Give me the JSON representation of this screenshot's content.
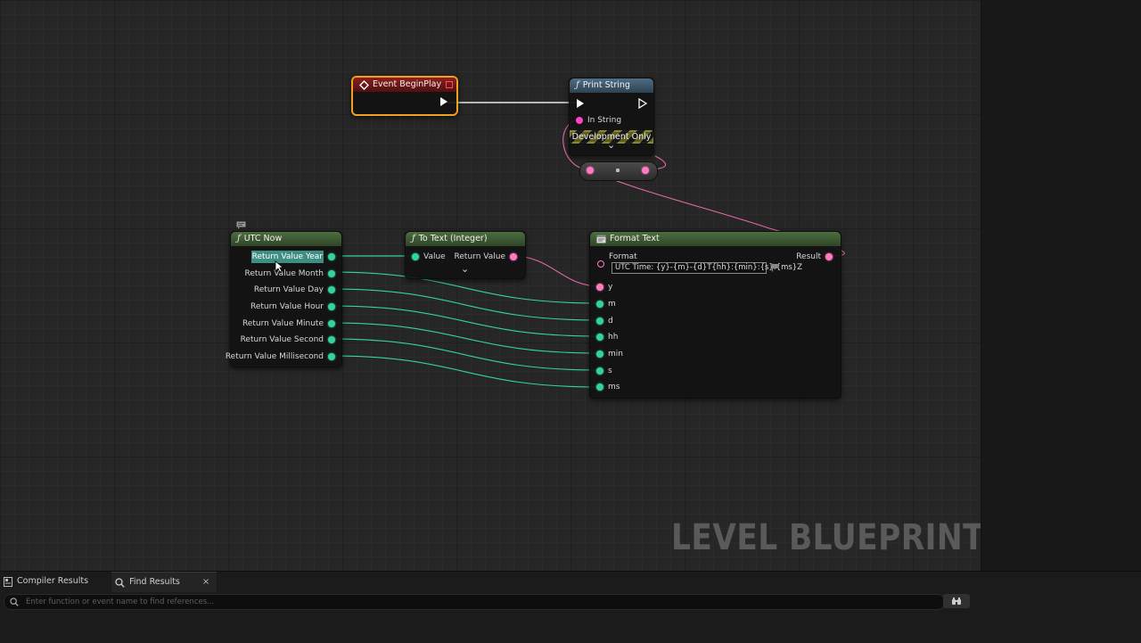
{
  "nodes": {
    "begin_play": {
      "title": "Event BeginPlay"
    },
    "print_string": {
      "title": "Print String",
      "in_string": "In String",
      "dev_only": "Development Only",
      "expand": "⌄"
    },
    "utc_now": {
      "title": "UTC Now",
      "outputs": [
        "Return Value Year",
        "Return Value Month",
        "Return Value Day",
        "Return Value Hour",
        "Return Value Minute",
        "Return Value Second",
        "Return Value Millisecond"
      ]
    },
    "to_text": {
      "title": "To Text (Integer)",
      "input": "Value",
      "output": "Return Value",
      "expand": "⌄"
    },
    "format_text": {
      "title": "Format Text",
      "format_label": "Format",
      "format_value": "UTC Time: {y}-{m}-{d}T{hh}:{min}:{s}:{ms}Z",
      "result": "Result",
      "inputs": [
        "y",
        "m",
        "d",
        "hh",
        "min",
        "s",
        "ms"
      ]
    }
  },
  "watermark": "LEVEL BLUEPRINT",
  "bottom": {
    "tabs": [
      {
        "label": "Compiler Results",
        "icon": "compiler-results-icon"
      },
      {
        "label": "Find Results",
        "icon": "search-icon",
        "close": "×"
      }
    ],
    "search_placeholder": "Enter function or event name to find references..."
  },
  "colors": {
    "exec_pin": "#ffffff",
    "int_pin": "#34d39c",
    "text_pin": "#ff7ac0",
    "string_pin": "#ff40c8",
    "pure_header": "#4c6d3f",
    "call_header": "#4f6d85",
    "event_header": "#8b1e1e",
    "selection_outline": "#f0a020"
  },
  "icons": [
    "event-icon",
    "function-icon",
    "format-text-icon",
    "flag-icon",
    "search-icon",
    "binoculars-icon",
    "comment-icon",
    "cursor-icon"
  ]
}
